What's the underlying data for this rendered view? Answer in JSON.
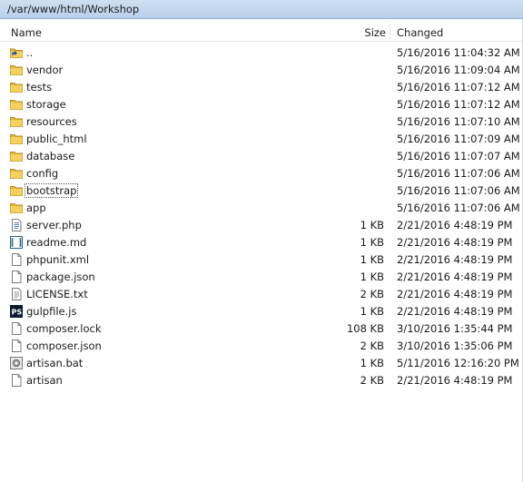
{
  "path": "/var/www/html/Workshop",
  "columns": {
    "name": "Name",
    "size": "Size",
    "changed": "Changed"
  },
  "files": [
    {
      "name": "..",
      "size": "",
      "changed": "5/16/2016 11:04:32 AM",
      "icon": "parent-folder-icon"
    },
    {
      "name": "vendor",
      "size": "",
      "changed": "5/16/2016 11:09:04 AM",
      "icon": "folder-icon"
    },
    {
      "name": "tests",
      "size": "",
      "changed": "5/16/2016 11:07:12 AM",
      "icon": "folder-icon"
    },
    {
      "name": "storage",
      "size": "",
      "changed": "5/16/2016 11:07:12 AM",
      "icon": "folder-icon"
    },
    {
      "name": "resources",
      "size": "",
      "changed": "5/16/2016 11:07:10 AM",
      "icon": "folder-icon"
    },
    {
      "name": "public_html",
      "size": "",
      "changed": "5/16/2016 11:07:09 AM",
      "icon": "folder-icon"
    },
    {
      "name": "database",
      "size": "",
      "changed": "5/16/2016 11:07:07 AM",
      "icon": "folder-icon"
    },
    {
      "name": "config",
      "size": "",
      "changed": "5/16/2016 11:07:06 AM",
      "icon": "folder-icon"
    },
    {
      "name": "bootstrap",
      "size": "",
      "changed": "5/16/2016 11:07:06 AM",
      "icon": "folder-icon",
      "focused": true
    },
    {
      "name": "app",
      "size": "",
      "changed": "5/16/2016 11:07:06 AM",
      "icon": "folder-icon"
    },
    {
      "name": "server.php",
      "size": "1 KB",
      "changed": "2/21/2016 4:48:19 PM",
      "icon": "php-file-icon"
    },
    {
      "name": "readme.md",
      "size": "1 KB",
      "changed": "2/21/2016 4:48:19 PM",
      "icon": "markdown-file-icon"
    },
    {
      "name": "phpunit.xml",
      "size": "1 KB",
      "changed": "2/21/2016 4:48:19 PM",
      "icon": "blank-file-icon"
    },
    {
      "name": "package.json",
      "size": "1 KB",
      "changed": "2/21/2016 4:48:19 PM",
      "icon": "blank-file-icon"
    },
    {
      "name": "LICENSE.txt",
      "size": "2 KB",
      "changed": "2/21/2016 4:48:19 PM",
      "icon": "text-file-icon"
    },
    {
      "name": "gulpfile.js",
      "size": "1 KB",
      "changed": "2/21/2016 4:48:19 PM",
      "icon": "ps-file-icon"
    },
    {
      "name": "composer.lock",
      "size": "108 KB",
      "changed": "3/10/2016 1:35:44 PM",
      "icon": "blank-file-icon"
    },
    {
      "name": "composer.json",
      "size": "2 KB",
      "changed": "3/10/2016 1:35:06 PM",
      "icon": "blank-file-icon"
    },
    {
      "name": "artisan.bat",
      "size": "1 KB",
      "changed": "5/11/2016 12:16:20 PM",
      "icon": "batch-file-icon"
    },
    {
      "name": "artisan",
      "size": "2 KB",
      "changed": "2/21/2016 4:48:19 PM",
      "icon": "blank-file-icon"
    }
  ],
  "colors": {
    "pathbar": "#c4d8f0",
    "folder": "#e8b83a"
  }
}
